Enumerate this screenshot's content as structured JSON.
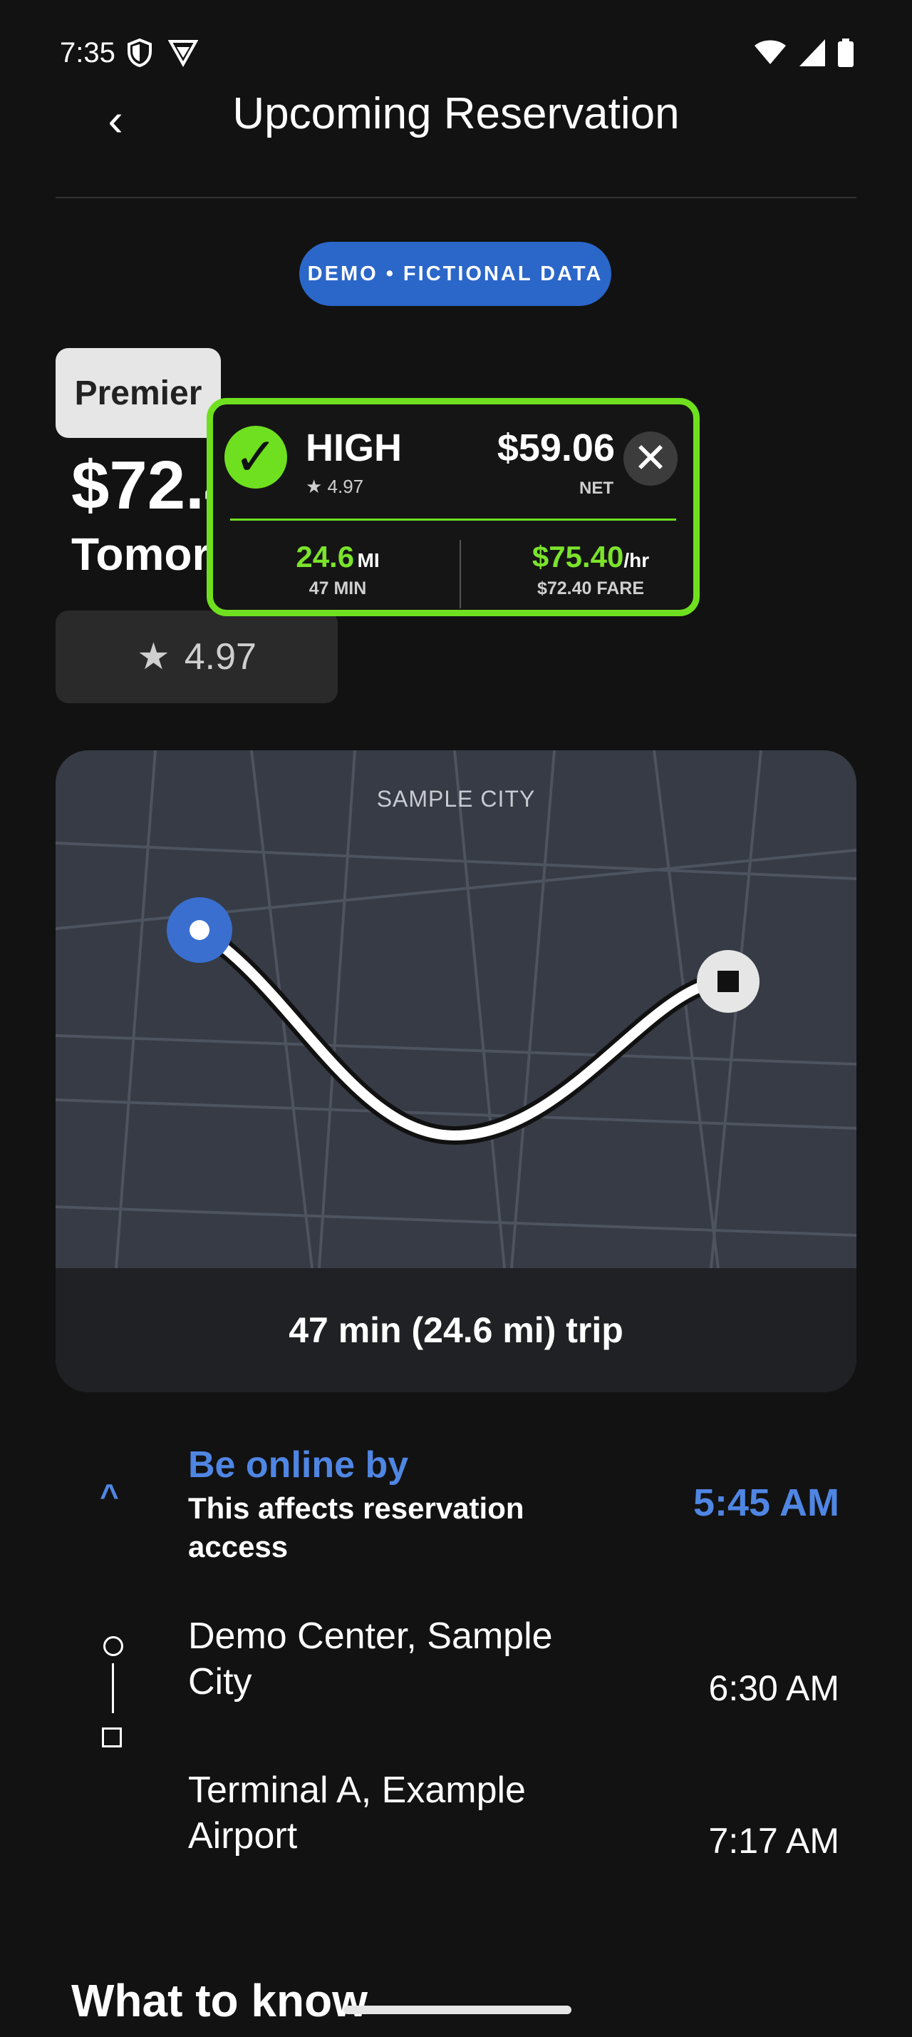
{
  "status": {
    "time": "7:35"
  },
  "header": {
    "back": "‹",
    "title": "Upcoming Reservation"
  },
  "demo_pill": "DEMO • FICTIONAL DATA",
  "ride": {
    "tier": "Premier",
    "fare": "$72.40",
    "when": "Tomorrow at 6:30 AM",
    "rating": "4.97",
    "star": "★"
  },
  "overlay": {
    "check": "✓",
    "label": "HIGH",
    "rating": "★ 4.97",
    "net": "$59.06",
    "net_label": "NET",
    "close": "✕",
    "distance": "24.6",
    "distance_unit": "MI",
    "duration": "47 MIN",
    "rate": "$75.40",
    "rate_unit": "/hr",
    "fare_label": "$72.40 FARE",
    "accent": "#6fe01f"
  },
  "map": {
    "city": "SAMPLE CITY",
    "trip": "47 min (24.6 mi) trip"
  },
  "online": {
    "title": "Be online by",
    "subtitle": "This affects reservation access",
    "time": "5:45 AM",
    "chevron": "^"
  },
  "stops": [
    {
      "name": "Demo Center, Sample City",
      "time": "6:30 AM"
    },
    {
      "name": "Terminal A, Example Airport",
      "time": "7:17 AM"
    }
  ],
  "section": {
    "what_to_know": "What to know"
  },
  "colors": {
    "background": "#121212",
    "blue": "#2b66c9",
    "accent_green": "#6fe01f"
  }
}
